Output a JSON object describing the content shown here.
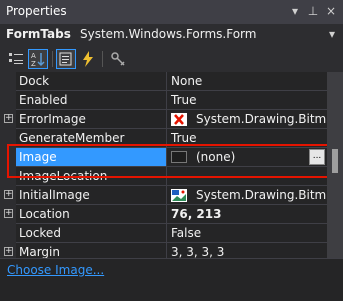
{
  "window": {
    "title": "Properties",
    "pin_glyph": "⊥",
    "menu_glyph": "▾",
    "close_glyph": "×"
  },
  "object_selector": {
    "name": "FormTabs",
    "type": "System.Windows.Forms.Form",
    "dropdown_glyph": "▾"
  },
  "toolbar": {
    "buttons": [
      {
        "icon": "categorized-icon"
      },
      {
        "icon": "alphabetical-icon",
        "selected": true
      },
      {
        "icon": "properties-icon",
        "selected": true
      },
      {
        "icon": "events-icon"
      },
      {
        "icon": "property-pages-icon"
      }
    ]
  },
  "rows": [
    {
      "name": "Dock",
      "value": "None"
    },
    {
      "name": "Enabled",
      "value": "True"
    },
    {
      "name": "ErrorImage",
      "value": "System.Drawing.Bitmap",
      "expandable": true,
      "value_icon": "bitmap-icon"
    },
    {
      "name": "GenerateMember",
      "value": "True"
    },
    {
      "name": "Image",
      "value": "(none)",
      "selected": true,
      "value_icon": "color-swatch",
      "has_ellipsis": true
    },
    {
      "name": "ImageLocation",
      "value": ""
    },
    {
      "name": "InitialImage",
      "value": "System.Drawing.Bitmap",
      "expandable": true,
      "value_icon": "bitmap-icon"
    },
    {
      "name": "Location",
      "value": "76, 213",
      "expandable": true,
      "bold_value": true
    },
    {
      "name": "Locked",
      "value": "False"
    },
    {
      "name": "Margin",
      "value": "3, 3, 3, 3",
      "expandable": true
    }
  ],
  "expand_glyph": "+",
  "ellipsis": "...",
  "commands": {
    "choose_image": "Choose Image..."
  },
  "colors": {
    "accent": "#3399ff",
    "highlight_box": "#e51400",
    "background": "#252526"
  }
}
